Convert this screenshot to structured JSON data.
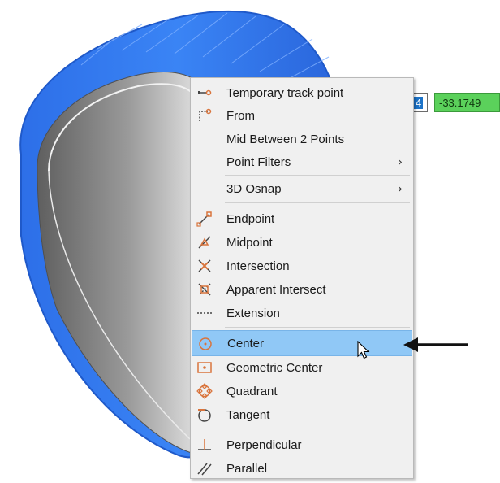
{
  "coordinates": {
    "x_value": "4",
    "y_value": "-33.1749"
  },
  "colors": {
    "solid_blue": "#2f78f0",
    "menu_bg": "#f0f0f0",
    "highlight": "#90c8f6",
    "snap_icon": "#d9743c",
    "coord_green": "#5bd15b"
  },
  "menu": {
    "items": [
      {
        "label": "Temporary track point",
        "icon": "temporary-track-point-icon"
      },
      {
        "label": "From",
        "icon": "from-icon"
      },
      {
        "label": "Mid Between 2 Points",
        "icon": ""
      },
      {
        "label": "Point Filters",
        "icon": "",
        "submenu": "›"
      },
      {
        "label": "3D Osnap",
        "icon": "",
        "submenu": "›"
      },
      {
        "label": "Endpoint",
        "icon": "endpoint-icon"
      },
      {
        "label": "Midpoint",
        "icon": "midpoint-icon"
      },
      {
        "label": "Intersection",
        "icon": "intersection-icon"
      },
      {
        "label": "Apparent Intersect",
        "icon": "apparent-intersect-icon"
      },
      {
        "label": "Extension",
        "icon": "extension-icon"
      },
      {
        "label": "Center",
        "icon": "center-icon",
        "highlighted": true
      },
      {
        "label": "Geometric Center",
        "icon": "geometric-center-icon"
      },
      {
        "label": "Quadrant",
        "icon": "quadrant-icon"
      },
      {
        "label": "Tangent",
        "icon": "tangent-icon"
      },
      {
        "label": "Perpendicular",
        "icon": "perpendicular-icon"
      },
      {
        "label": "Parallel",
        "icon": "parallel-icon"
      }
    ]
  }
}
